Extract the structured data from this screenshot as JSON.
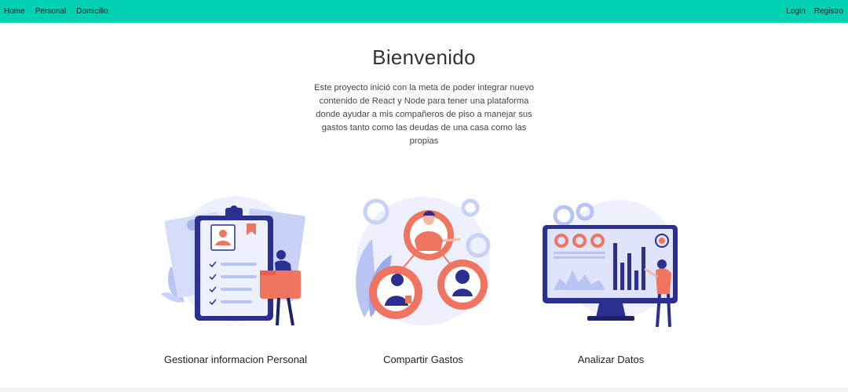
{
  "navbar": {
    "left_links": [
      "Home",
      "Personal",
      "Domicilio"
    ],
    "right_links": [
      "Login",
      "Registro"
    ],
    "color": "#00d1b2"
  },
  "hero": {
    "title": "Bienvenido",
    "description": "Este proyecto inició con la meta de poder integrar nuevo contenido de React y Node para tener una plataforma donde ayudar a mis compañeros de piso a manejar sus gastos tanto como las deudas de una casa como las propias"
  },
  "features": [
    {
      "label": "Gestionar informacion Personal",
      "icon": "clipboard-profile-illustration"
    },
    {
      "label": "Compartir Gastos",
      "icon": "people-gears-illustration"
    },
    {
      "label": "Analizar Datos",
      "icon": "monitor-analytics-illustration"
    }
  ],
  "colors": {
    "navy": "#2b2f8f",
    "coral": "#f07561",
    "lavender": "#dfe3fb",
    "periwinkle": "#b8c4f2"
  }
}
